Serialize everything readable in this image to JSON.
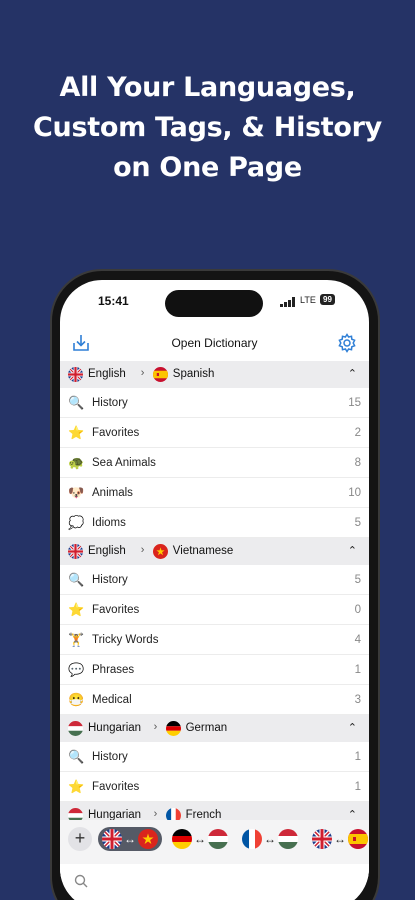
{
  "headline": {
    "line1": "All Your Languages,",
    "line2": "Custom Tags, & History",
    "line3": "on One Page"
  },
  "status": {
    "time": "15:41",
    "network": "LTE",
    "battery": "99"
  },
  "navbar": {
    "title": "Open Dictionary",
    "left_icon": "import-icon",
    "right_icon": "gear-icon"
  },
  "sections": [
    {
      "from": "English",
      "to": "Spanish",
      "from_flag": "flag-uk",
      "to_flag": "flag-spain",
      "items": [
        {
          "emoji": "🔍",
          "label": "History",
          "count": "15"
        },
        {
          "emoji": "⭐",
          "label": "Favorites",
          "count": "2"
        },
        {
          "emoji": "🐢",
          "label": "Sea Animals",
          "count": "8"
        },
        {
          "emoji": "🐶",
          "label": "Animals",
          "count": "10"
        },
        {
          "emoji": "💭",
          "label": "Idioms",
          "count": "5"
        }
      ]
    },
    {
      "from": "English",
      "to": "Vietnamese",
      "from_flag": "flag-uk",
      "to_flag": "flag-vietnam",
      "items": [
        {
          "emoji": "🔍",
          "label": "History",
          "count": "5"
        },
        {
          "emoji": "⭐",
          "label": "Favorites",
          "count": "0"
        },
        {
          "emoji": "🏋",
          "label": "Tricky Words",
          "count": "4"
        },
        {
          "emoji": "💬",
          "label": "Phrases",
          "count": "1"
        },
        {
          "emoji": "😷",
          "label": "Medical",
          "count": "3"
        }
      ]
    },
    {
      "from": "Hungarian",
      "to": "German",
      "from_flag": "flag-hungary",
      "to_flag": "flag-germany",
      "items": [
        {
          "emoji": "🔍",
          "label": "History",
          "count": "1"
        },
        {
          "emoji": "⭐",
          "label": "Favorites",
          "count": "1"
        }
      ]
    },
    {
      "from": "Hungarian",
      "to": "French",
      "from_flag": "flag-hungary",
      "to_flag": "flag-france",
      "items": []
    }
  ],
  "pair_bar": {
    "add_label": "+",
    "swap_symbol": "↔",
    "pairs": [
      {
        "a": "flag-uk",
        "b": "flag-vietnam",
        "active": true
      },
      {
        "a": "flag-germany",
        "b": "flag-hungary",
        "active": false
      },
      {
        "a": "flag-france",
        "b": "flag-hungary",
        "active": false
      },
      {
        "a": "flag-uk",
        "b": "flag-spain",
        "active": false
      }
    ]
  },
  "search": {
    "icon": "search-icon",
    "placeholder": ""
  },
  "colors": {
    "background": "#253366",
    "accent": "#2f7fd6",
    "section_bg": "#ececee"
  }
}
